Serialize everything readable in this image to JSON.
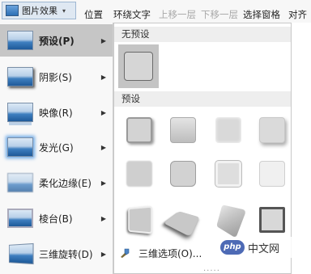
{
  "ribbon": {
    "picture_effects_label": "图片效果",
    "position_label": "位置",
    "wrap_text_label": "环绕文字",
    "bring_forward_label": "上移一层",
    "send_backward_label": "下移一层",
    "selection_pane_label": "选择窗格",
    "align_label": "对齐"
  },
  "menu": {
    "items": [
      {
        "label": "预设(P)",
        "key": "P",
        "effect": "preset",
        "active": true
      },
      {
        "label": "阴影(S)",
        "key": "S",
        "effect": "shadow"
      },
      {
        "label": "映像(R)",
        "key": "R",
        "effect": "reflection"
      },
      {
        "label": "发光(G)",
        "key": "G",
        "effect": "glow"
      },
      {
        "label": "柔化边缘(E)",
        "key": "E",
        "effect": "soft-edges"
      },
      {
        "label": "棱台(B)",
        "key": "B",
        "effect": "bevel"
      },
      {
        "label": "三维旋转(D)",
        "key": "D",
        "effect": "3d-rotation"
      }
    ]
  },
  "submenu": {
    "no_preset_heading": "无预设",
    "presets_heading": "预设",
    "preset_count": 12,
    "options_label": "三维选项(O)...",
    "grip_text": "....."
  },
  "watermark": {
    "logo_text": "php",
    "text": "中文网"
  },
  "colors": {
    "menu_active_bg": "#c6c6c6",
    "section_header_bg": "#eeeeee",
    "picture_thumb_blue": "#2c6fb5"
  }
}
